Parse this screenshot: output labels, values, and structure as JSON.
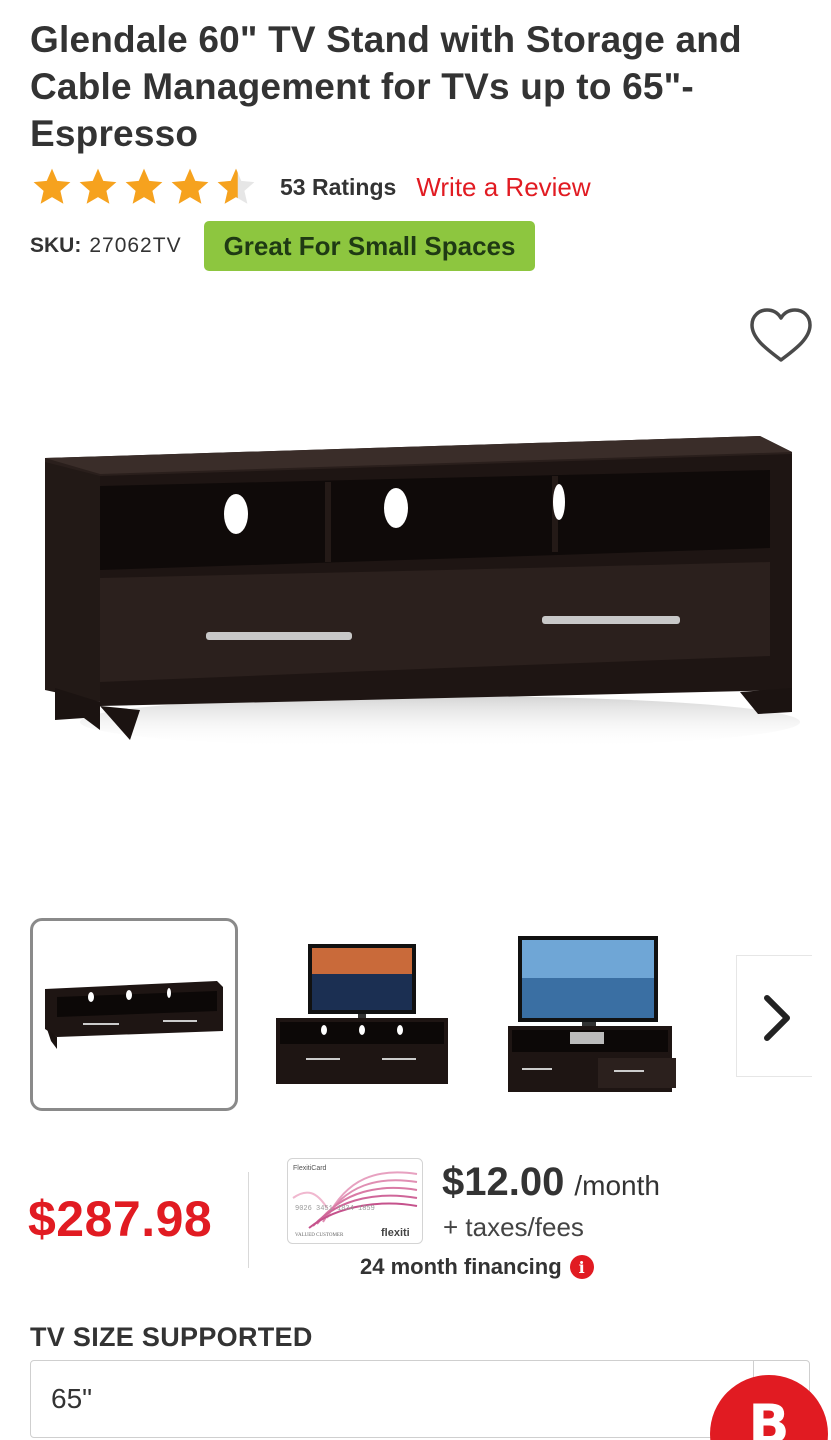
{
  "product": {
    "title": "Glendale 60\" TV Stand with Storage and Cable Management for TVs up to 65\"- Espresso",
    "rating": 4.5,
    "rating_max": 5,
    "ratings_count_label": "53 Ratings",
    "write_review_label": "Write a Review",
    "sku_label": "SKU:",
    "sku_value": "27062TV",
    "badge_label": "Great For Small Spaces"
  },
  "gallery": {
    "selected_index": 0,
    "thumbnails": [
      "tv-stand-front",
      "tv-stand-with-tv-lifestyle",
      "tv-stand-with-tv-open-drawer"
    ],
    "next_icon": "chevron-right-icon"
  },
  "pricing": {
    "price": "$287.98",
    "card_issuer_label": "FlexitiCard",
    "card_number_label": "9026 3451 1834 1859",
    "card_holder_label": "VALUED CUSTOMER",
    "card_brand_label": "flexiti",
    "monthly_amount": "$12.00",
    "monthly_unit": "/month",
    "taxes_label": "+ taxes/fees",
    "financing_label": "24 month financing",
    "info_icon_glyph": "i"
  },
  "options": {
    "tv_size_label": "TV SIZE SUPPORTED",
    "tv_size_value": "65\""
  },
  "chat": {
    "letter": "B"
  },
  "colors": {
    "accent_red": "#e11b22",
    "star_orange": "#f6a21e",
    "badge_green": "#8dc63f"
  }
}
